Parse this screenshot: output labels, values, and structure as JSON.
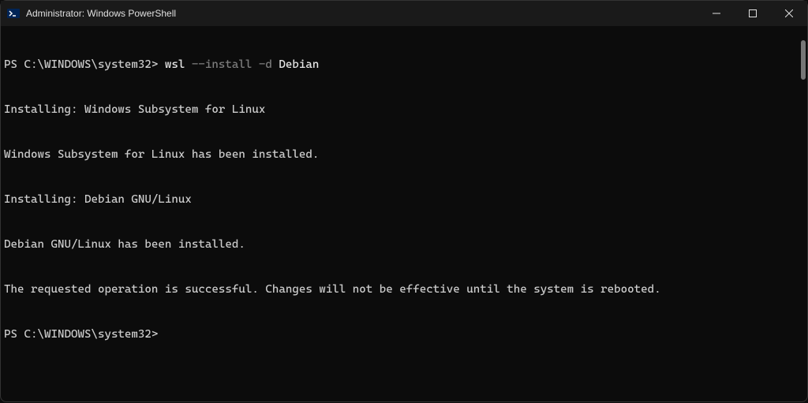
{
  "window": {
    "title": "Administrator: Windows PowerShell"
  },
  "terminal": {
    "prompt1": "PS C:\\WINDOWS\\system32> ",
    "cmd_wsl": "wsl",
    "cmd_flag": " --install -d",
    "cmd_arg": " Debian",
    "line2": "Installing: Windows Subsystem for Linux",
    "line3": "Windows Subsystem for Linux has been installed.",
    "line4": "Installing: Debian GNU/Linux",
    "line5": "Debian GNU/Linux has been installed.",
    "line6": "The requested operation is successful. Changes will not be effective until the system is rebooted.",
    "prompt2": "PS C:\\WINDOWS\\system32>"
  }
}
